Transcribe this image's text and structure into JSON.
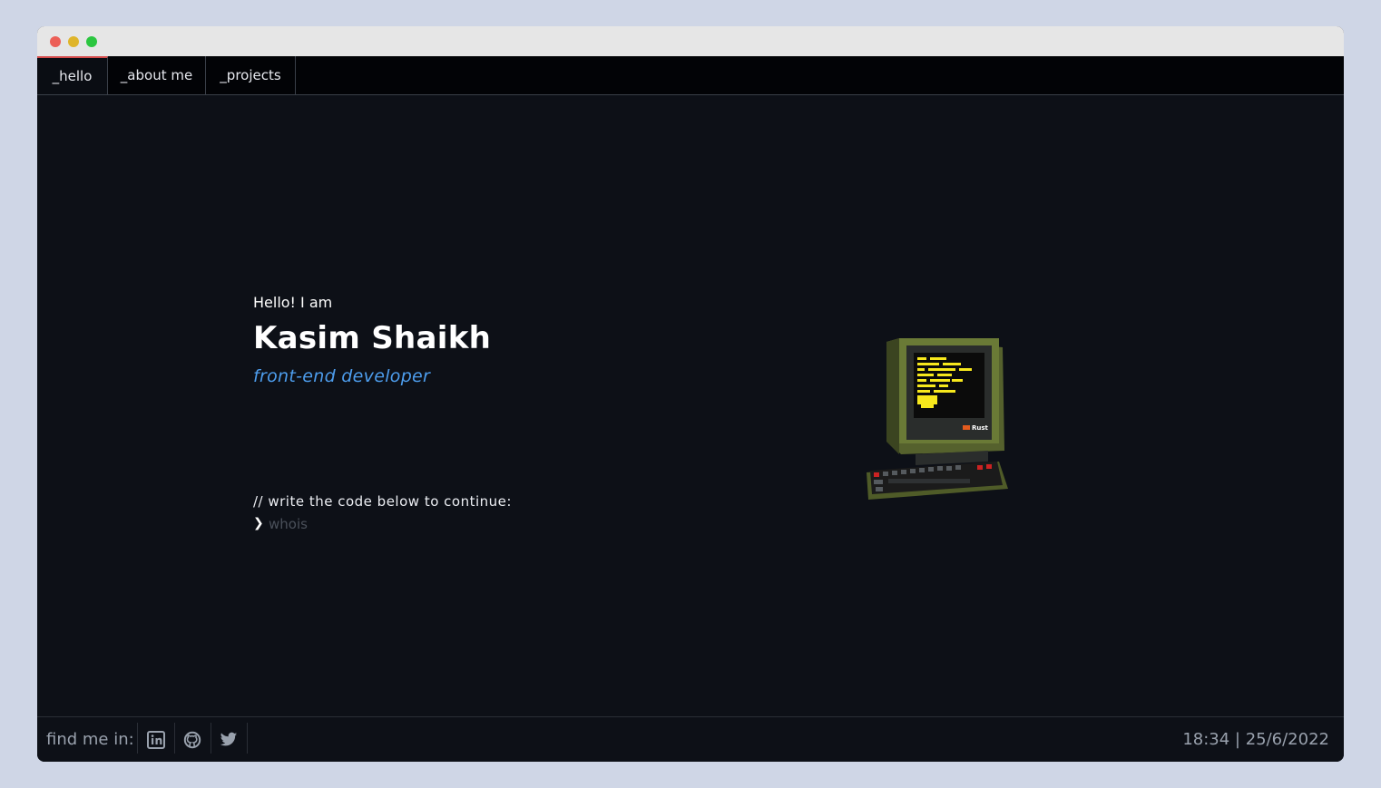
{
  "nav": {
    "tabs": [
      {
        "label": "_hello",
        "active": true
      },
      {
        "label": "_about me",
        "active": false
      },
      {
        "label": "_projects",
        "active": false
      }
    ]
  },
  "hero": {
    "greeting": "Hello! I am",
    "name": "Kasim Shaikh",
    "role": "front-end developer"
  },
  "terminal": {
    "comment": "//  write the code below to continue:",
    "prompt_symbol": "❯",
    "input_value": "",
    "input_placeholder": "whois"
  },
  "illustration": {
    "icon": "retro-computer-icon",
    "screen_text": "Rust"
  },
  "footer": {
    "find_label": "find me in:",
    "socials": [
      {
        "name": "linkedin-icon"
      },
      {
        "name": "github-icon"
      },
      {
        "name": "twitter-icon"
      }
    ],
    "datetime": "18:34 | 25/6/2022"
  },
  "colors": {
    "page_bg": "#cfd6e6",
    "window_bg": "#0d1017",
    "accent_blue": "#4d9ded",
    "active_tab_border": "#d54c4c",
    "terminal_text": "#f7e81c"
  }
}
